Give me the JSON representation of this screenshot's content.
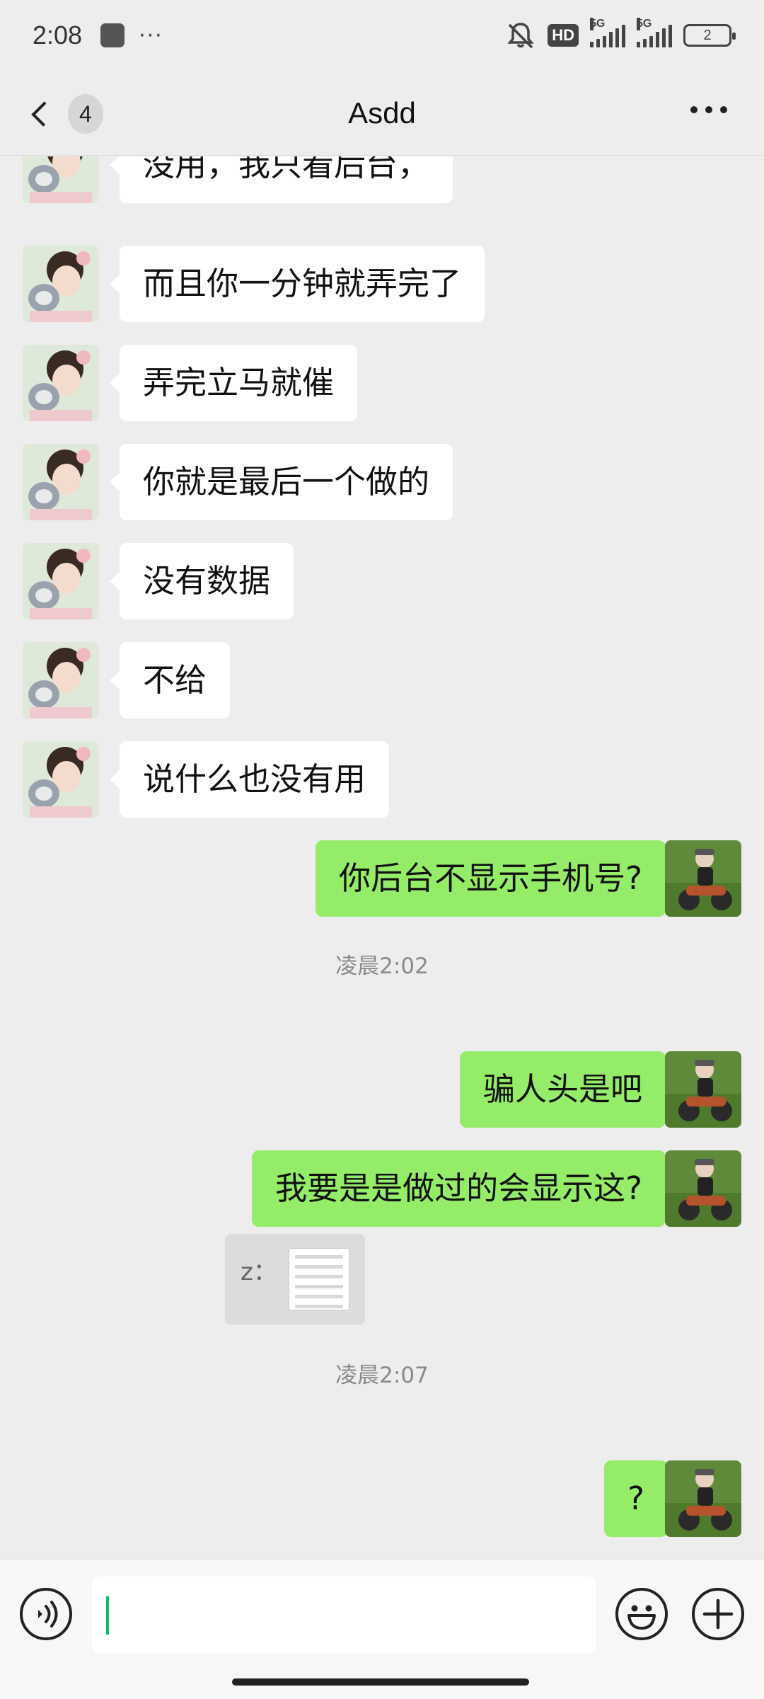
{
  "status_bar": {
    "time": "2:08",
    "more": "···",
    "hd_label": "HD",
    "signal_1": "5G",
    "signal_2": "5G",
    "battery": "2"
  },
  "header": {
    "back_badge": "4",
    "title": "Asdd"
  },
  "messages": [
    {
      "type": "text",
      "side": "in",
      "text": "没用，我只看后台，"
    },
    {
      "type": "text",
      "side": "in",
      "text": "而且你一分钟就弄完了"
    },
    {
      "type": "text",
      "side": "in",
      "text": "弄完立马就催"
    },
    {
      "type": "text",
      "side": "in",
      "text": "你就是最后一个做的"
    },
    {
      "type": "text",
      "side": "in",
      "text": "没有数据"
    },
    {
      "type": "text",
      "side": "in",
      "text": "不给"
    },
    {
      "type": "text",
      "side": "in",
      "text": "说什么也没有用"
    },
    {
      "type": "text",
      "side": "out",
      "text": "你后台不显示手机号?"
    },
    {
      "type": "time",
      "text": "凌晨2:02"
    },
    {
      "type": "text",
      "side": "out",
      "text": "骗人头是吧"
    },
    {
      "type": "text",
      "side": "out",
      "text": "我要是是做过的会显示这?"
    },
    {
      "type": "quote",
      "label": "z："
    },
    {
      "type": "time",
      "text": "凌晨2:07"
    },
    {
      "type": "text",
      "side": "out",
      "text": "?"
    }
  ],
  "icons": {
    "voice": "voice-icon",
    "emoji": "smiley-icon",
    "plus": "plus-icon",
    "back": "chevron-left-icon",
    "more": "more-dots-icon"
  },
  "colors": {
    "background": "#ededed",
    "outgoing_bubble": "#95ec69",
    "incoming_bubble": "#ffffff",
    "caret": "#07c160"
  }
}
